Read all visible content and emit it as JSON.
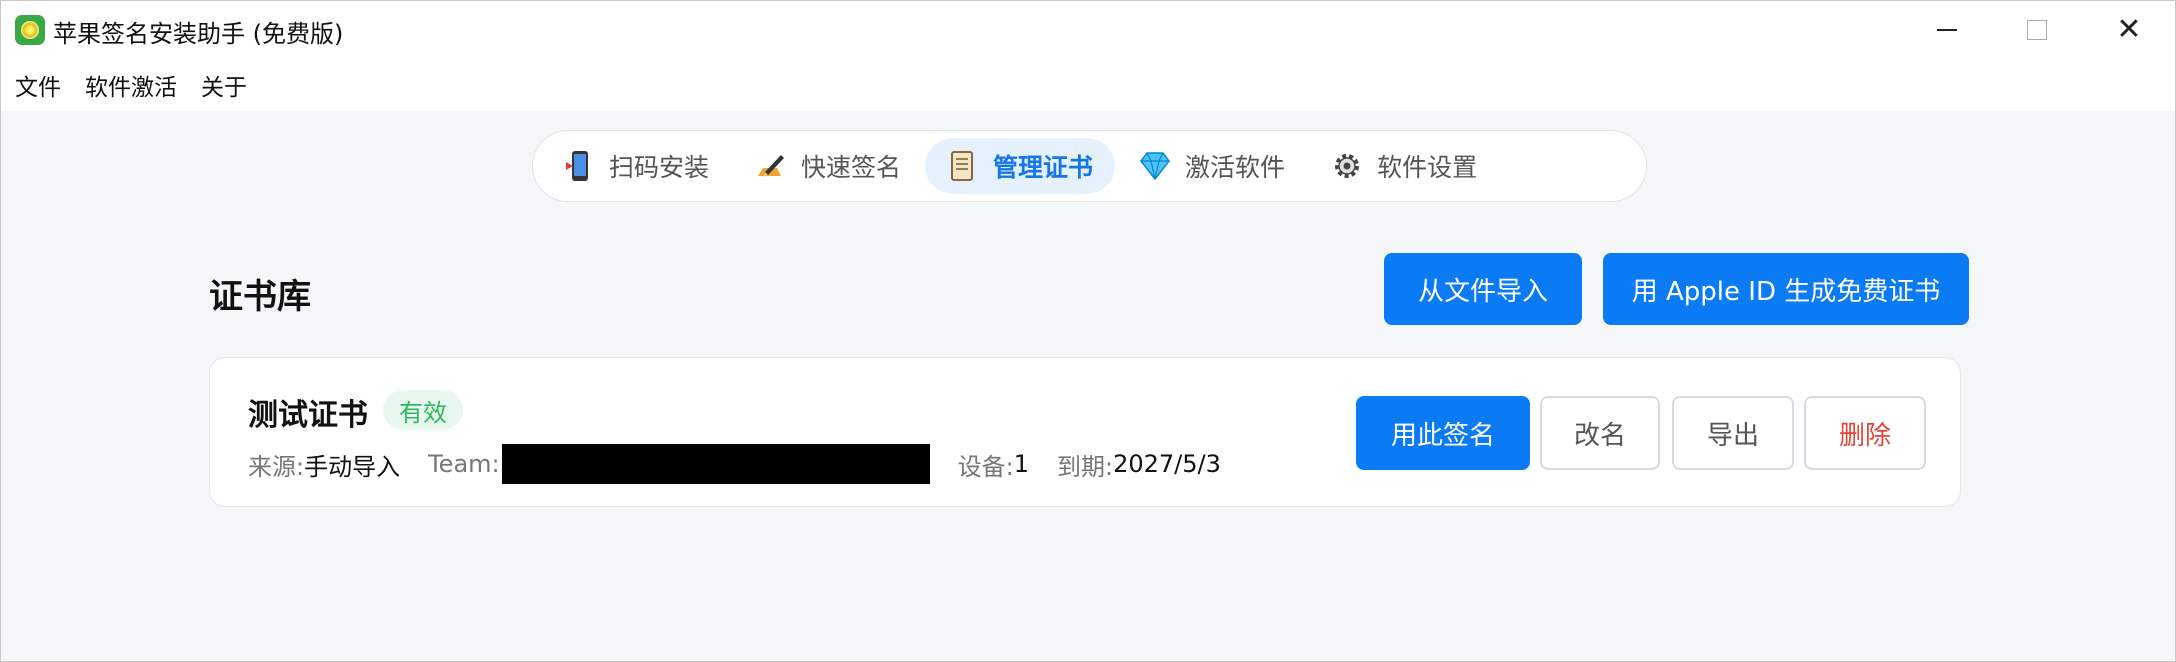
{
  "window": {
    "title": "苹果签名安装助手 (免费版)",
    "minimize_glyph": "",
    "close_glyph": "✕"
  },
  "menu": [
    "文件",
    "软件激活",
    "关于"
  ],
  "tabs": [
    {
      "label": "扫码安装",
      "icon": "phone-icon",
      "active": false
    },
    {
      "label": "快速签名",
      "icon": "pen-icon",
      "active": false
    },
    {
      "label": "管理证书",
      "icon": "scroll-icon",
      "active": true
    },
    {
      "label": "激活软件",
      "icon": "diamond-icon",
      "active": false
    },
    {
      "label": "软件设置",
      "icon": "gear-icon",
      "active": false
    }
  ],
  "page": {
    "title": "证书库",
    "import_label": "从文件导入",
    "appleid_label": "用 Apple ID 生成免费证书"
  },
  "certificates": [
    {
      "name": "测试证书",
      "status": "有效",
      "source_label": "来源:",
      "source_value": "手动导入",
      "team_label": "Team:",
      "devices_label": "设备:",
      "devices_value": "1",
      "expiry_label": "到期:",
      "expiry_value": "2027/5/3",
      "sign_label": "用此签名",
      "rename_label": "改名",
      "export_label": "导出",
      "delete_label": "删除"
    }
  ],
  "colors": {
    "accent": "#0a7af5",
    "active_tab_bg": "#e6f1fe",
    "status_green": "#2fb760",
    "danger": "#e0463a"
  }
}
